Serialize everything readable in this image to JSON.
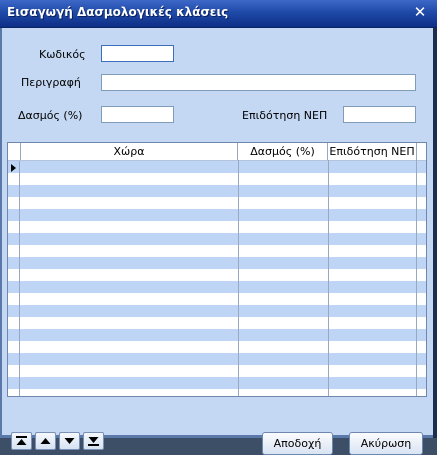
{
  "window": {
    "title": "Εισαγωγή Δασμολογικές κλάσεις"
  },
  "form": {
    "code_label": "Κωδικός",
    "code_value": "",
    "description_label": "Περιγραφή",
    "description_value": "",
    "duty_label": "Δασμός (%)",
    "duty_value": "",
    "subsidy_label": "Επιδότηση ΝΕΠ",
    "subsidy_value": ""
  },
  "grid": {
    "columns": [
      "Χώρα",
      "Δασμός (%)",
      "Επιδότηση ΝΕΠ"
    ]
  },
  "buttons": {
    "accept": "Αποδοχή",
    "cancel": "Ακύρωση"
  },
  "icons": {
    "close": "close-icon",
    "nav_first": "nav-first-icon",
    "nav_prev": "nav-up-icon",
    "nav_next": "nav-down-icon",
    "nav_last": "nav-last-icon",
    "current_row": "current-row-indicator-icon"
  },
  "colors": {
    "titlebar": "#1f4aa8",
    "client": "#c5d8f3",
    "grid_alt_row": "#bfd5f5"
  }
}
